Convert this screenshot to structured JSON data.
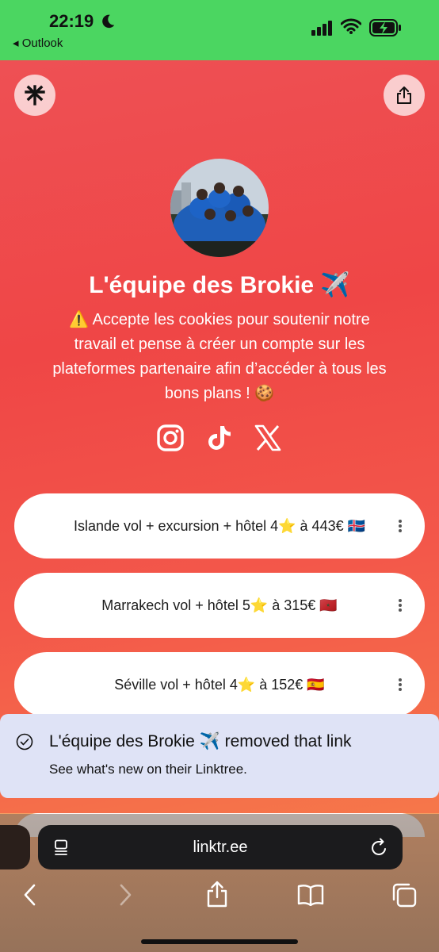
{
  "status_bar": {
    "time": "22:19",
    "back_app": "◂ Outlook",
    "color": "#4bd661"
  },
  "profile": {
    "name": "L'équipe des Brokie ✈️",
    "bio": "⚠️ Accepte les cookies pour soutenir notre travail et pense à créer un compte sur les plateformes partenaire afin d’accéder à tous les bons plans ! 🍪"
  },
  "socials": [
    "instagram-icon",
    "tiktok-icon",
    "x-icon"
  ],
  "links": [
    {
      "label": "Islande vol + excursion + hôtel 4⭐️ à 443€ 🇮🇸"
    },
    {
      "label": "Marrakech vol + hôtel 5⭐️ à 315€ 🇲🇦"
    },
    {
      "label": "Séville vol + hôtel 4⭐️ à 152€ 🇪🇸"
    }
  ],
  "toast": {
    "title": "L'équipe des Brokie ✈️ removed that link",
    "subtitle": "See what's new on their Linktree."
  },
  "browser": {
    "url": "linktr.ee"
  }
}
